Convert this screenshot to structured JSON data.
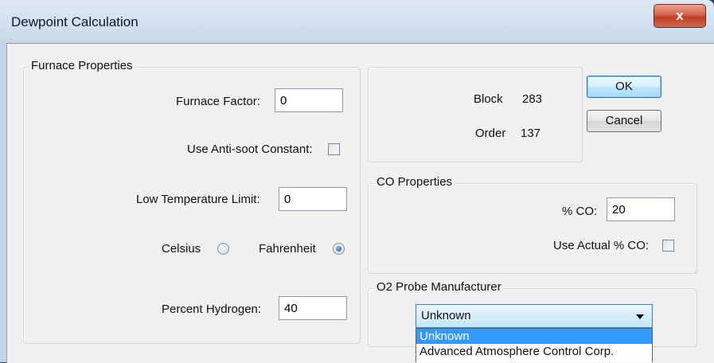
{
  "window": {
    "title": "Dewpoint Calculation",
    "close_glyph": "x"
  },
  "furnace": {
    "legend": "Furnace Properties",
    "furnace_factor_label": "Furnace Factor:",
    "furnace_factor_value": "0",
    "anti_soot_label": "Use Anti-soot Constant:",
    "anti_soot_checked": false,
    "low_temp_label": "Low Temperature Limit:",
    "low_temp_value": "0",
    "celsius_label": "Celsius",
    "fahrenheit_label": "Fahrenheit",
    "selected_unit": "Fahrenheit",
    "hydrogen_label": "Percent Hydrogen:",
    "hydrogen_value": "40"
  },
  "info": {
    "block_label": "Block",
    "block_value": "283",
    "order_label": "Order",
    "order_value": "137"
  },
  "buttons": {
    "ok": "OK",
    "cancel": "Cancel"
  },
  "co": {
    "legend": "CO Properties",
    "percent_label": "% CO:",
    "percent_value": "20",
    "use_actual_label": "Use Actual % CO:",
    "use_actual_checked": false
  },
  "o2": {
    "legend": "O2 Probe Manufacturer",
    "selected": "Unknown",
    "options": [
      "Unknown",
      "Advanced Atmosphere Control Corp."
    ]
  },
  "colors": {
    "selection": "#3399ff",
    "default_button_border": "#2e6fb5",
    "close_button": "#c7472c"
  }
}
